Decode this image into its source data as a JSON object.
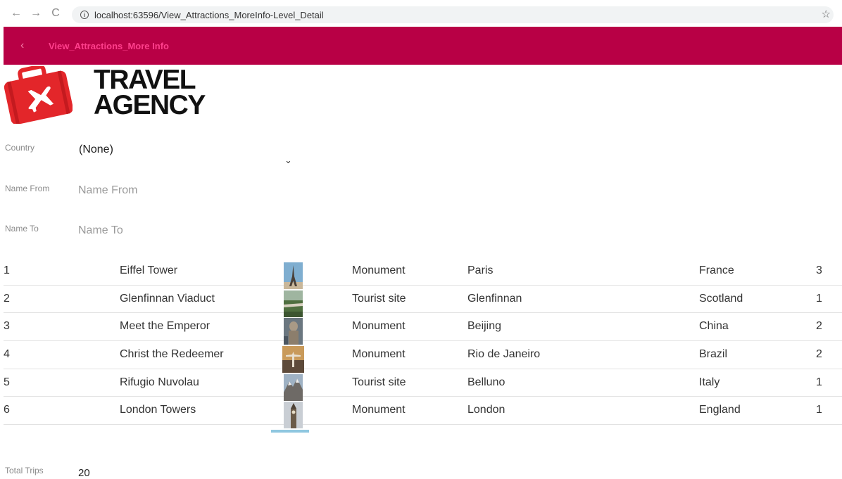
{
  "browser": {
    "url": "localhost:63596/View_Attractions_MoreInfo-Level_Detail",
    "back_icon": "←",
    "forward_icon": "→",
    "reload_icon": "C",
    "star_icon": "☆"
  },
  "header": {
    "back_icon": "‹",
    "title": "View_Attractions_More Info",
    "color": "#b80045"
  },
  "logo": {
    "line1": "TRAVEL",
    "line2": "AGENCY",
    "icon": "suitcase-plane-icon"
  },
  "form": {
    "country_label": "Country",
    "country_value": "(None)",
    "chevron": "⌄",
    "name_from_label": "Name From",
    "name_from_placeholder": "Name From",
    "name_to_label": "Name To",
    "name_to_placeholder": "Name To"
  },
  "attractions": [
    {
      "id": "1",
      "name": "Eiffel Tower",
      "type": "Monument",
      "city": "Paris",
      "country": "France",
      "trips": "3"
    },
    {
      "id": "2",
      "name": "Glenfinnan Viaduct",
      "type": "Tourist site",
      "city": "Glenfinnan",
      "country": "Scotland",
      "trips": "1"
    },
    {
      "id": "3",
      "name": "Meet the Emperor",
      "type": "Monument",
      "city": "Beijing",
      "country": "China",
      "trips": "2"
    },
    {
      "id": "4",
      "name": "Christ the Redeemer",
      "type": "Monument",
      "city": "Rio de Janeiro",
      "country": "Brazil",
      "trips": "2"
    },
    {
      "id": "5",
      "name": "Rifugio Nuvolau",
      "type": "Tourist site",
      "city": "Belluno",
      "country": "Italy",
      "trips": "1"
    },
    {
      "id": "6",
      "name": "London Towers",
      "type": "Monument",
      "city": "London",
      "country": "England",
      "trips": "1"
    }
  ],
  "total": {
    "label": "Total Trips",
    "value": "20"
  }
}
